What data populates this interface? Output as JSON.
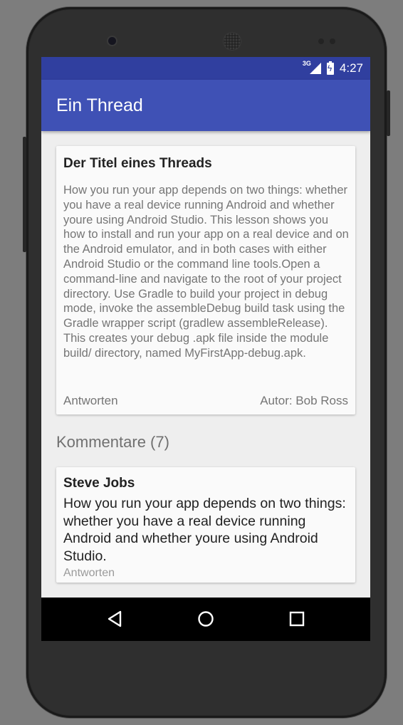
{
  "status_bar": {
    "network": "3G",
    "time": "4:27"
  },
  "app_bar": {
    "title": "Ein Thread"
  },
  "thread": {
    "title": "Der Titel eines Threads",
    "body": "How you run your app depends on two things: whether you have a real device running Android and whether youre using Android Studio. This lesson shows you how to install and run your app on a real device and on the Android emulator, and in both cases with either Android Studio or the command line tools.Open a command-line and navigate to the root of your project directory. Use Gradle to build your project in debug mode, invoke the assembleDebug build task using the Gradle wrapper script (gradlew assembleRelease). This creates your debug .apk file inside the module build/ directory, named MyFirstApp-debug.apk.",
    "reply_label": "Antworten",
    "author_label": "Autor: Bob Ross"
  },
  "comments": {
    "heading": "Kommentare (7)",
    "items": [
      {
        "author": "Steve Jobs",
        "body": "How you run your app depends on two things: whether you have a real device running Android and whether youre using Android Studio.",
        "reply_label": "Antworten"
      }
    ]
  },
  "navigation": {
    "buttons": [
      "back",
      "home",
      "recents"
    ]
  },
  "colors": {
    "primary": "#3f51b5",
    "primary_dark": "#303f9f",
    "background": "#eeeeee",
    "card": "#fafafa"
  }
}
